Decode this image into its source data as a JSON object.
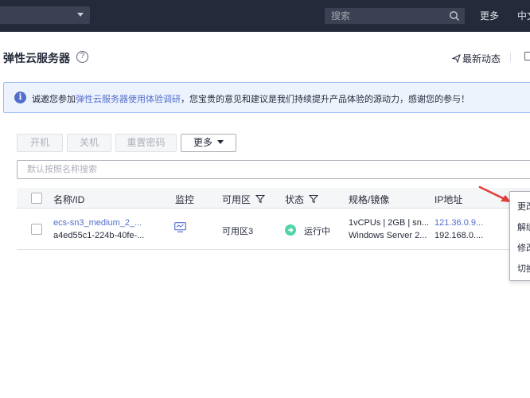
{
  "topbar": {
    "search_placeholder": "搜索",
    "more_label": "更多",
    "language_label": "中文"
  },
  "header": {
    "title": "弹性云服务器",
    "help_glyph": "?",
    "news_label": "最新动态"
  },
  "notice": {
    "info_glyph": "i",
    "prefix": "诚邀您参加",
    "link": "弹性云服务器使用体验调研",
    "suffix": "，您宝贵的意见和建议是我们持续提升产品体验的源动力，感谢您的参与！"
  },
  "toolbar": {
    "start_label": "开机",
    "stop_label": "关机",
    "reset_password_label": "重置密码",
    "more_label": "更多"
  },
  "filter": {
    "placeholder": "默认按照名称搜索"
  },
  "table": {
    "columns": {
      "name_id": "名称/ID",
      "monitor": "监控",
      "az": "可用区",
      "status": "状态",
      "spec": "规格/镜像",
      "ip": "IP地址"
    },
    "rows": [
      {
        "name": "ecs-sn3_medium_2_...",
        "id": "a4ed55c1-224b-40fe-...",
        "az": "可用区3",
        "status": "运行中",
        "spec": "1vCPUs | 2GB | sn...",
        "image": "Windows Server 2...",
        "public_ip": "121.36.0.9...",
        "private_ip": "192.168.0...."
      }
    ]
  },
  "dropdown_menu": {
    "items": [
      "更改",
      "解绑",
      "修改",
      "切换"
    ]
  },
  "colors": {
    "topbar_bg": "#252a3a",
    "link": "#526ecc",
    "status_running": "#50d4ab",
    "annotation_arrow": "#e0403a"
  }
}
